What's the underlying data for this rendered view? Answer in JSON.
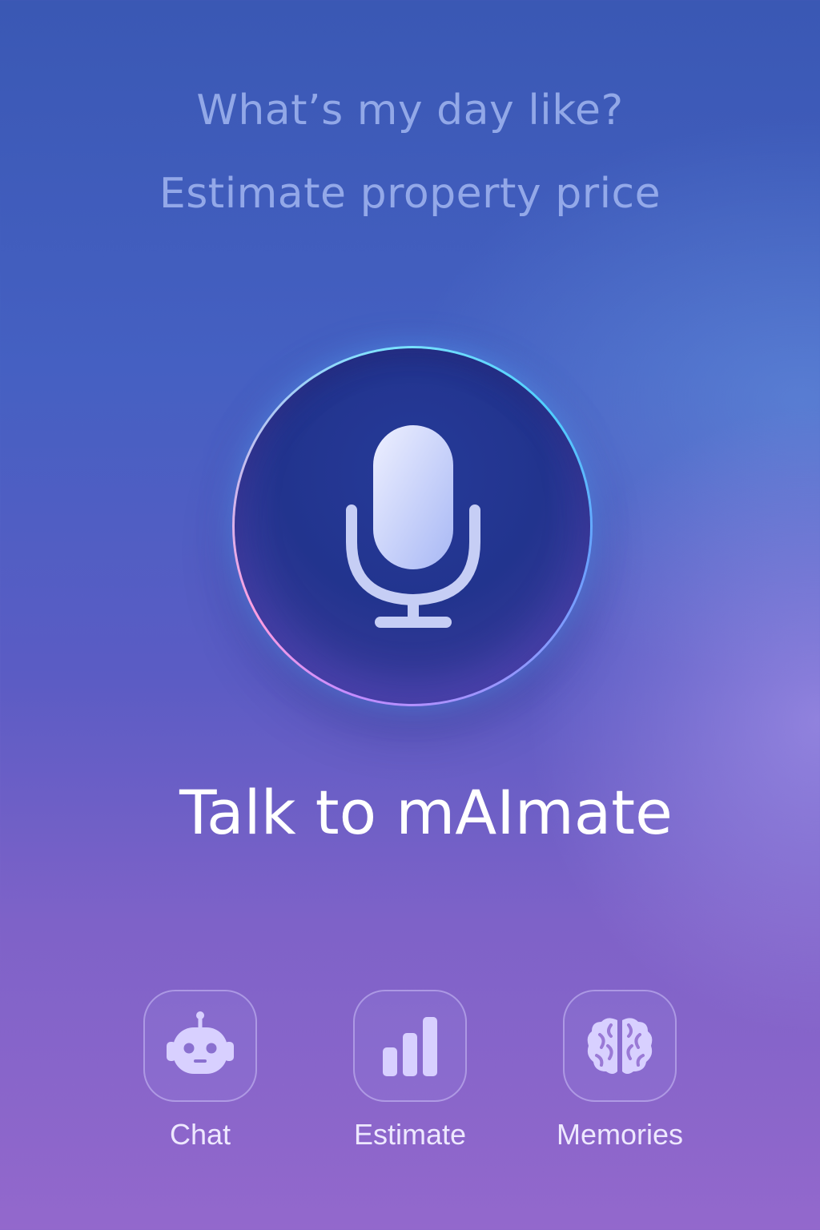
{
  "suggestions": [
    "What’s my day like?",
    "Estimate property price"
  ],
  "mic": {
    "icon": "microphone-icon"
  },
  "headline": "Talk to mAImate",
  "nav": {
    "chat": {
      "label": "Chat",
      "icon": "robot-icon"
    },
    "estimate": {
      "label": "Estimate",
      "icon": "bar-chart-icon"
    },
    "memories": {
      "label": "Memories",
      "icon": "brain-icon"
    }
  },
  "colors": {
    "suggestion_text": "#aabef5",
    "headline_text": "#ffffff",
    "icon_fill": "#d8d0ff"
  }
}
